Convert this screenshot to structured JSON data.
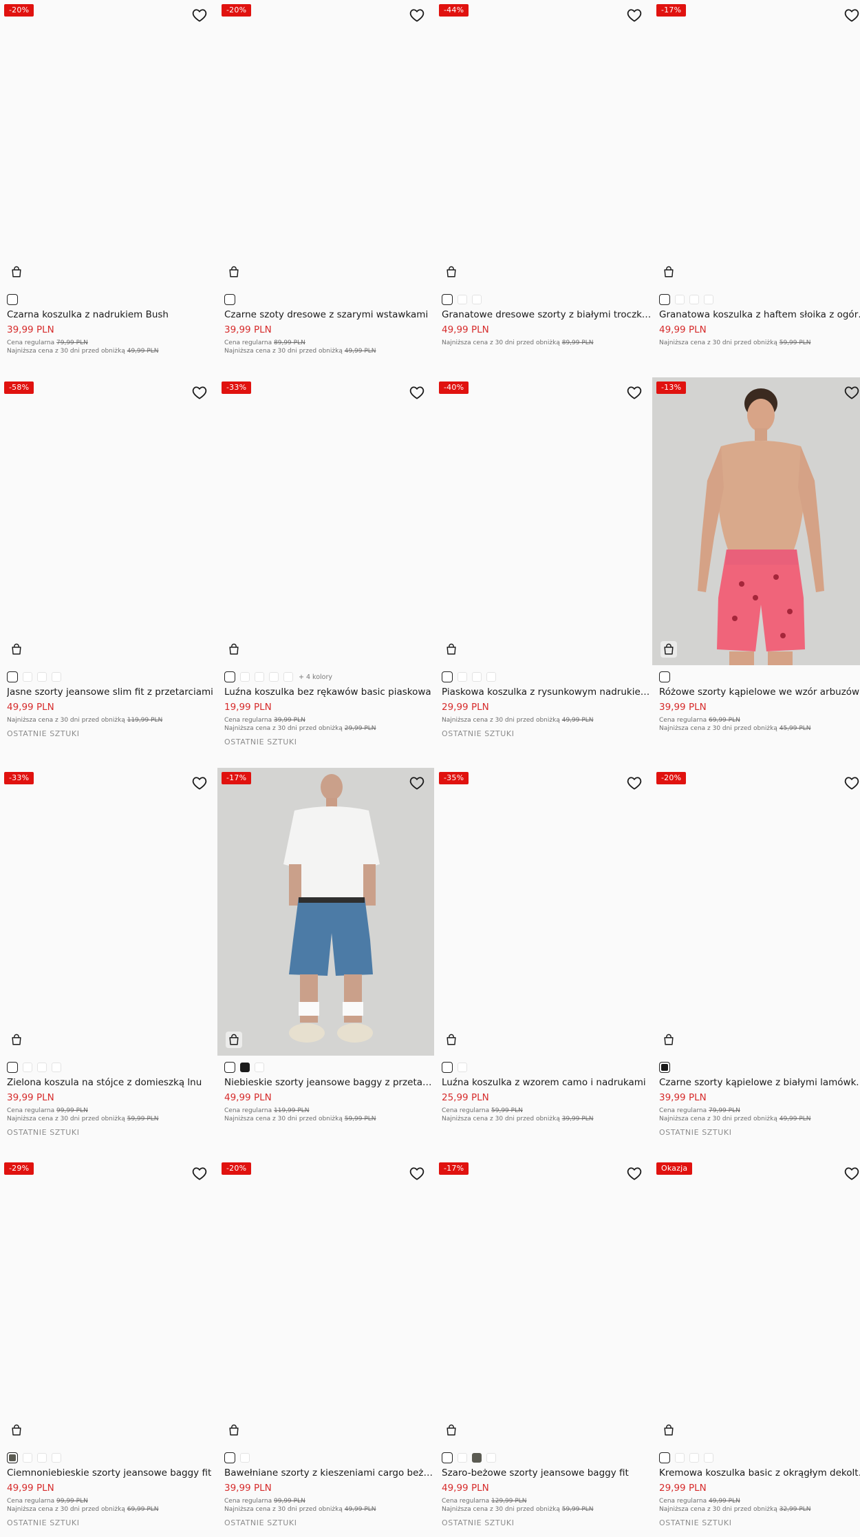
{
  "products": [
    {
      "badge": "-20%",
      "name": "Czarna koszulka z nadrukiem Bush",
      "price": "39,99 PLN",
      "regular_label": "Cena regularna",
      "regular": "79,99 PLN",
      "lowest_label": "Najniższa cena z 30 dni przed obniżką",
      "lowest": "49,99 PLN",
      "last": "",
      "swatches": [
        {
          "color": "#ffffff",
          "selected": true
        }
      ],
      "more": ""
    },
    {
      "badge": "-20%",
      "name": "Czarne szoty dresowe z szarymi wstawkami",
      "price": "39,99 PLN",
      "regular_label": "Cena regularna",
      "regular": "89,99 PLN",
      "lowest_label": "Najniższa cena z 30 dni przed obniżką",
      "lowest": "49,99 PLN",
      "last": "",
      "swatches": [
        {
          "color": "#ffffff",
          "selected": true
        }
      ],
      "more": ""
    },
    {
      "badge": "-44%",
      "name": "Granatowe dresowe szorty z białymi troczkami",
      "price": "49,99 PLN",
      "regular_label": "",
      "regular": "",
      "lowest_label": "Najniższa cena z 30 dni przed obniżką",
      "lowest": "89,99 PLN",
      "last": "",
      "swatches": [
        {
          "color": "#ffffff",
          "selected": true
        },
        {
          "color": "#ffffff"
        },
        {
          "color": "#ffffff"
        }
      ],
      "more": ""
    },
    {
      "badge": "-17%",
      "name": "Granatowa koszulka z haftem słoika z ogórkami",
      "price": "49,99 PLN",
      "regular_label": "",
      "regular": "",
      "lowest_label": "Najniższa cena z 30 dni przed obniżką",
      "lowest": "59,99 PLN",
      "last": "",
      "swatches": [
        {
          "color": "#ffffff",
          "selected": true
        },
        {
          "color": "#ffffff"
        },
        {
          "color": "#ffffff"
        },
        {
          "color": "#ffffff"
        }
      ],
      "more": ""
    },
    {
      "badge": "-58%",
      "name": "Jasne szorty jeansowe slim fit z przetarciami",
      "price": "49,99 PLN",
      "regular_label": "",
      "regular": "",
      "lowest_label": "Najniższa cena z 30 dni przed obniżką",
      "lowest": "119,99 PLN",
      "last": "OSTATNIE SZTUKI",
      "swatches": [
        {
          "color": "#ffffff",
          "selected": true
        },
        {
          "color": "#ffffff"
        },
        {
          "color": "#ffffff"
        },
        {
          "color": "#ffffff"
        }
      ],
      "more": ""
    },
    {
      "badge": "-33%",
      "name": "Luźna koszulka bez rękawów basic piaskowa",
      "price": "19,99 PLN",
      "regular_label": "Cena regularna",
      "regular": "39,99 PLN",
      "lowest_label": "Najniższa cena z 30 dni przed obniżką",
      "lowest": "29,99 PLN",
      "last": "OSTATNIE SZTUKI",
      "swatches": [
        {
          "color": "#ffffff",
          "selected": true
        },
        {
          "color": "#ffffff"
        },
        {
          "color": "#ffffff"
        },
        {
          "color": "#ffffff"
        },
        {
          "color": "#ffffff"
        }
      ],
      "more": "+ 4 kolory"
    },
    {
      "badge": "-40%",
      "name": "Piaskowa koszulka z rysunkowym nadrukiem i haftem",
      "price": "29,99 PLN",
      "regular_label": "",
      "regular": "",
      "lowest_label": "Najniższa cena z 30 dni przed obniżką",
      "lowest": "49,99 PLN",
      "last": "OSTATNIE SZTUKI",
      "swatches": [
        {
          "color": "#ffffff",
          "selected": true
        },
        {
          "color": "#ffffff"
        },
        {
          "color": "#ffffff"
        },
        {
          "color": "#ffffff"
        }
      ],
      "more": ""
    },
    {
      "badge": "-13%",
      "name": "Różowe szorty kąpielowe we wzór arbuzów",
      "price": "39,99 PLN",
      "regular_label": "Cena regularna",
      "regular": "69,99 PLN",
      "lowest_label": "Najniższa cena z 30 dni przed obniżką",
      "lowest": "45,99 PLN",
      "last": "",
      "swatches": [
        {
          "color": "#ffffff",
          "selected": true
        }
      ],
      "more": ""
    },
    {
      "badge": "-33%",
      "name": "Zielona koszula na stójce z domieszką lnu",
      "price": "39,99 PLN",
      "regular_label": "Cena regularna",
      "regular": "99,99 PLN",
      "lowest_label": "Najniższa cena z 30 dni przed obniżką",
      "lowest": "59,99 PLN",
      "last": "OSTATNIE SZTUKI",
      "swatches": [
        {
          "color": "#ffffff",
          "selected": true
        },
        {
          "color": "#ffffff"
        },
        {
          "color": "#ffffff"
        },
        {
          "color": "#ffffff"
        }
      ],
      "more": ""
    },
    {
      "badge": "-17%",
      "name": "Niebieskie szorty jeansowe baggy z przetarciami",
      "price": "49,99 PLN",
      "regular_label": "Cena regularna",
      "regular": "119,99 PLN",
      "lowest_label": "Najniższa cena z 30 dni przed obniżką",
      "lowest": "59,99 PLN",
      "last": "",
      "swatches": [
        {
          "color": "#ffffff",
          "selected": true
        },
        {
          "color": "#1a1a1a"
        },
        {
          "color": "#ffffff"
        }
      ],
      "more": ""
    },
    {
      "badge": "-35%",
      "name": "Luźna koszulka z wzorem camo i nadrukami",
      "price": "25,99 PLN",
      "regular_label": "Cena regularna",
      "regular": "59,99 PLN",
      "lowest_label": "Najniższa cena z 30 dni przed obniżką",
      "lowest": "39,99 PLN",
      "last": "",
      "swatches": [
        {
          "color": "#ffffff",
          "selected": true
        },
        {
          "color": "#ffffff"
        }
      ],
      "more": ""
    },
    {
      "badge": "-20%",
      "name": "Czarne szorty kąpielowe z białymi lamówkami",
      "price": "39,99 PLN",
      "regular_label": "Cena regularna",
      "regular": "79,99 PLN",
      "lowest_label": "Najniższa cena z 30 dni przed obniżką",
      "lowest": "49,99 PLN",
      "last": "OSTATNIE SZTUKI",
      "swatches": [
        {
          "color": "#1a1a1a",
          "selected": true
        }
      ],
      "more": ""
    },
    {
      "badge": "-29%",
      "name": "Ciemnoniebieskie szorty jeansowe baggy fit",
      "price": "49,99 PLN",
      "regular_label": "Cena regularna",
      "regular": "99,99 PLN",
      "lowest_label": "Najniższa cena z 30 dni przed obniżką",
      "lowest": "69,99 PLN",
      "last": "OSTATNIE SZTUKI",
      "swatches": [
        {
          "color": "#5b5b52",
          "selected": true
        },
        {
          "color": "#ffffff"
        },
        {
          "color": "#ffffff"
        },
        {
          "color": "#ffffff"
        }
      ],
      "more": ""
    },
    {
      "badge": "-20%",
      "name": "Bawełniane szorty z kieszeniami cargo beżowe",
      "price": "39,99 PLN",
      "regular_label": "Cena regularna",
      "regular": "99,99 PLN",
      "lowest_label": "Najniższa cena z 30 dni przed obniżką",
      "lowest": "49,99 PLN",
      "last": "OSTATNIE SZTUKI",
      "swatches": [
        {
          "color": "#ffffff",
          "selected": true
        },
        {
          "color": "#ffffff"
        }
      ],
      "more": ""
    },
    {
      "badge": "-17%",
      "name": "Szaro-beżowe szorty jeansowe baggy fit",
      "price": "49,99 PLN",
      "regular_label": "Cena regularna",
      "regular": "129,99 PLN",
      "lowest_label": "Najniższa cena z 30 dni przed obniżką",
      "lowest": "59,99 PLN",
      "last": "OSTATNIE SZTUKI",
      "swatches": [
        {
          "color": "#ffffff",
          "selected": true
        },
        {
          "color": "#ffffff"
        },
        {
          "color": "#5b5b52"
        },
        {
          "color": "#ffffff"
        }
      ],
      "more": ""
    },
    {
      "badge": "Okazja",
      "name": "Kremowa koszulka basic z okrągłym dekoltem",
      "price": "29,99 PLN",
      "regular_label": "Cena regularna",
      "regular": "49,99 PLN",
      "lowest_label": "Najniższa cena z 30 dni przed obniżką",
      "lowest": "32,99 PLN",
      "last": "OSTATNIE SZTUKI",
      "swatches": [
        {
          "color": "#ffffff",
          "selected": true
        },
        {
          "color": "#ffffff"
        },
        {
          "color": "#ffffff"
        },
        {
          "color": "#ffffff"
        }
      ],
      "more": ""
    }
  ],
  "icons": {
    "favorite": "heart-outline-icon",
    "cart": "shopping-bag-icon"
  },
  "colors": {
    "badge": "#e0120f",
    "price": "#d62b2b",
    "background": "#fafafa"
  }
}
